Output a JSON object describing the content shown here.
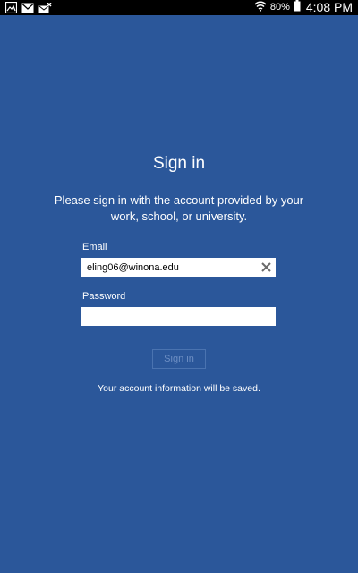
{
  "status_bar": {
    "notification_icons": [
      "gallery-icon",
      "email-icon",
      "missed-email-icon"
    ],
    "wifi_icon": "wifi-icon",
    "battery_percent": "80%",
    "battery_icon": "battery-icon",
    "time": "4:08 PM"
  },
  "signin": {
    "title": "Sign in",
    "subtitle": "Please sign in with the account provided by your work, school, or university.",
    "email_label": "Email",
    "email_value": "eling06@winona.edu",
    "clear_icon": "close-icon",
    "password_label": "Password",
    "password_value": "",
    "signin_button": "Sign in",
    "save_note": "Your account information will be saved."
  },
  "colors": {
    "background": "#2b579a",
    "status_bar": "#000000",
    "button_text_disabled": "#6e8fc4"
  }
}
